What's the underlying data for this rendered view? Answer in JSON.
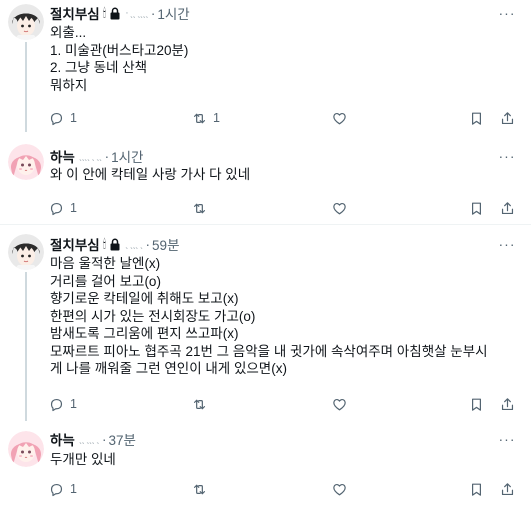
{
  "tweets": [
    {
      "author": "절치부심",
      "emoji": "🕯",
      "handle": "· ˎˎ ˎˎˎˎ",
      "time": "1시간",
      "lines": [
        "외출...",
        "1. 미술관(버스타고20분)",
        "2. 그냥 동네 산책",
        "뭐하지"
      ],
      "replies": "1",
      "retweets": "1",
      "likes": ""
    },
    {
      "author": "하늑",
      "emoji": "",
      "handle": "ˎˎˎˎ ˎ ˎˎ",
      "time": "1시간",
      "lines": [
        "와 이 안에 칵테일 사랑 가사 다 있네"
      ],
      "replies": "1",
      "retweets": "",
      "likes": ""
    },
    {
      "author": "절치부심",
      "emoji": "🕯",
      "handle": "ˎ ˎˎˎ ˎ",
      "time": "59분",
      "lines": [
        "마음 울적한 날엔(x)",
        "거리를 걸어 보고(o)",
        "향기로운 칵테일에 취해도 보고(x)",
        "한편의 시가 있는 전시회장도 가고(o)",
        "밤새도록 그리움에 편지 쓰고파(x)",
        "모짜르트 피아노 협주곡 21번 그 음악을 내 귓가에 속삭여주며 아침햇살 눈부시",
        "게 나를 깨워줄 그런 연인이 내게 있으면(x)"
      ],
      "replies": "1",
      "retweets": "",
      "likes": ""
    },
    {
      "author": "하늑",
      "emoji": "",
      "handle": "ˎˎ ˎˎˎ ˎ",
      "time": "37분",
      "lines": [
        "두개만 있네"
      ],
      "replies": "1",
      "retweets": "",
      "likes": ""
    }
  ],
  "colors": {
    "text": "#0f1419",
    "secondary": "#536471",
    "divider": "#eff3f4",
    "thread_line": "#cfd9de"
  },
  "icons": {
    "reply": "reply-icon",
    "retweet": "retweet-icon",
    "like": "heart-icon",
    "bookmark": "bookmark-icon",
    "share": "share-icon",
    "more": "more-icon",
    "lock": "lock-icon"
  }
}
